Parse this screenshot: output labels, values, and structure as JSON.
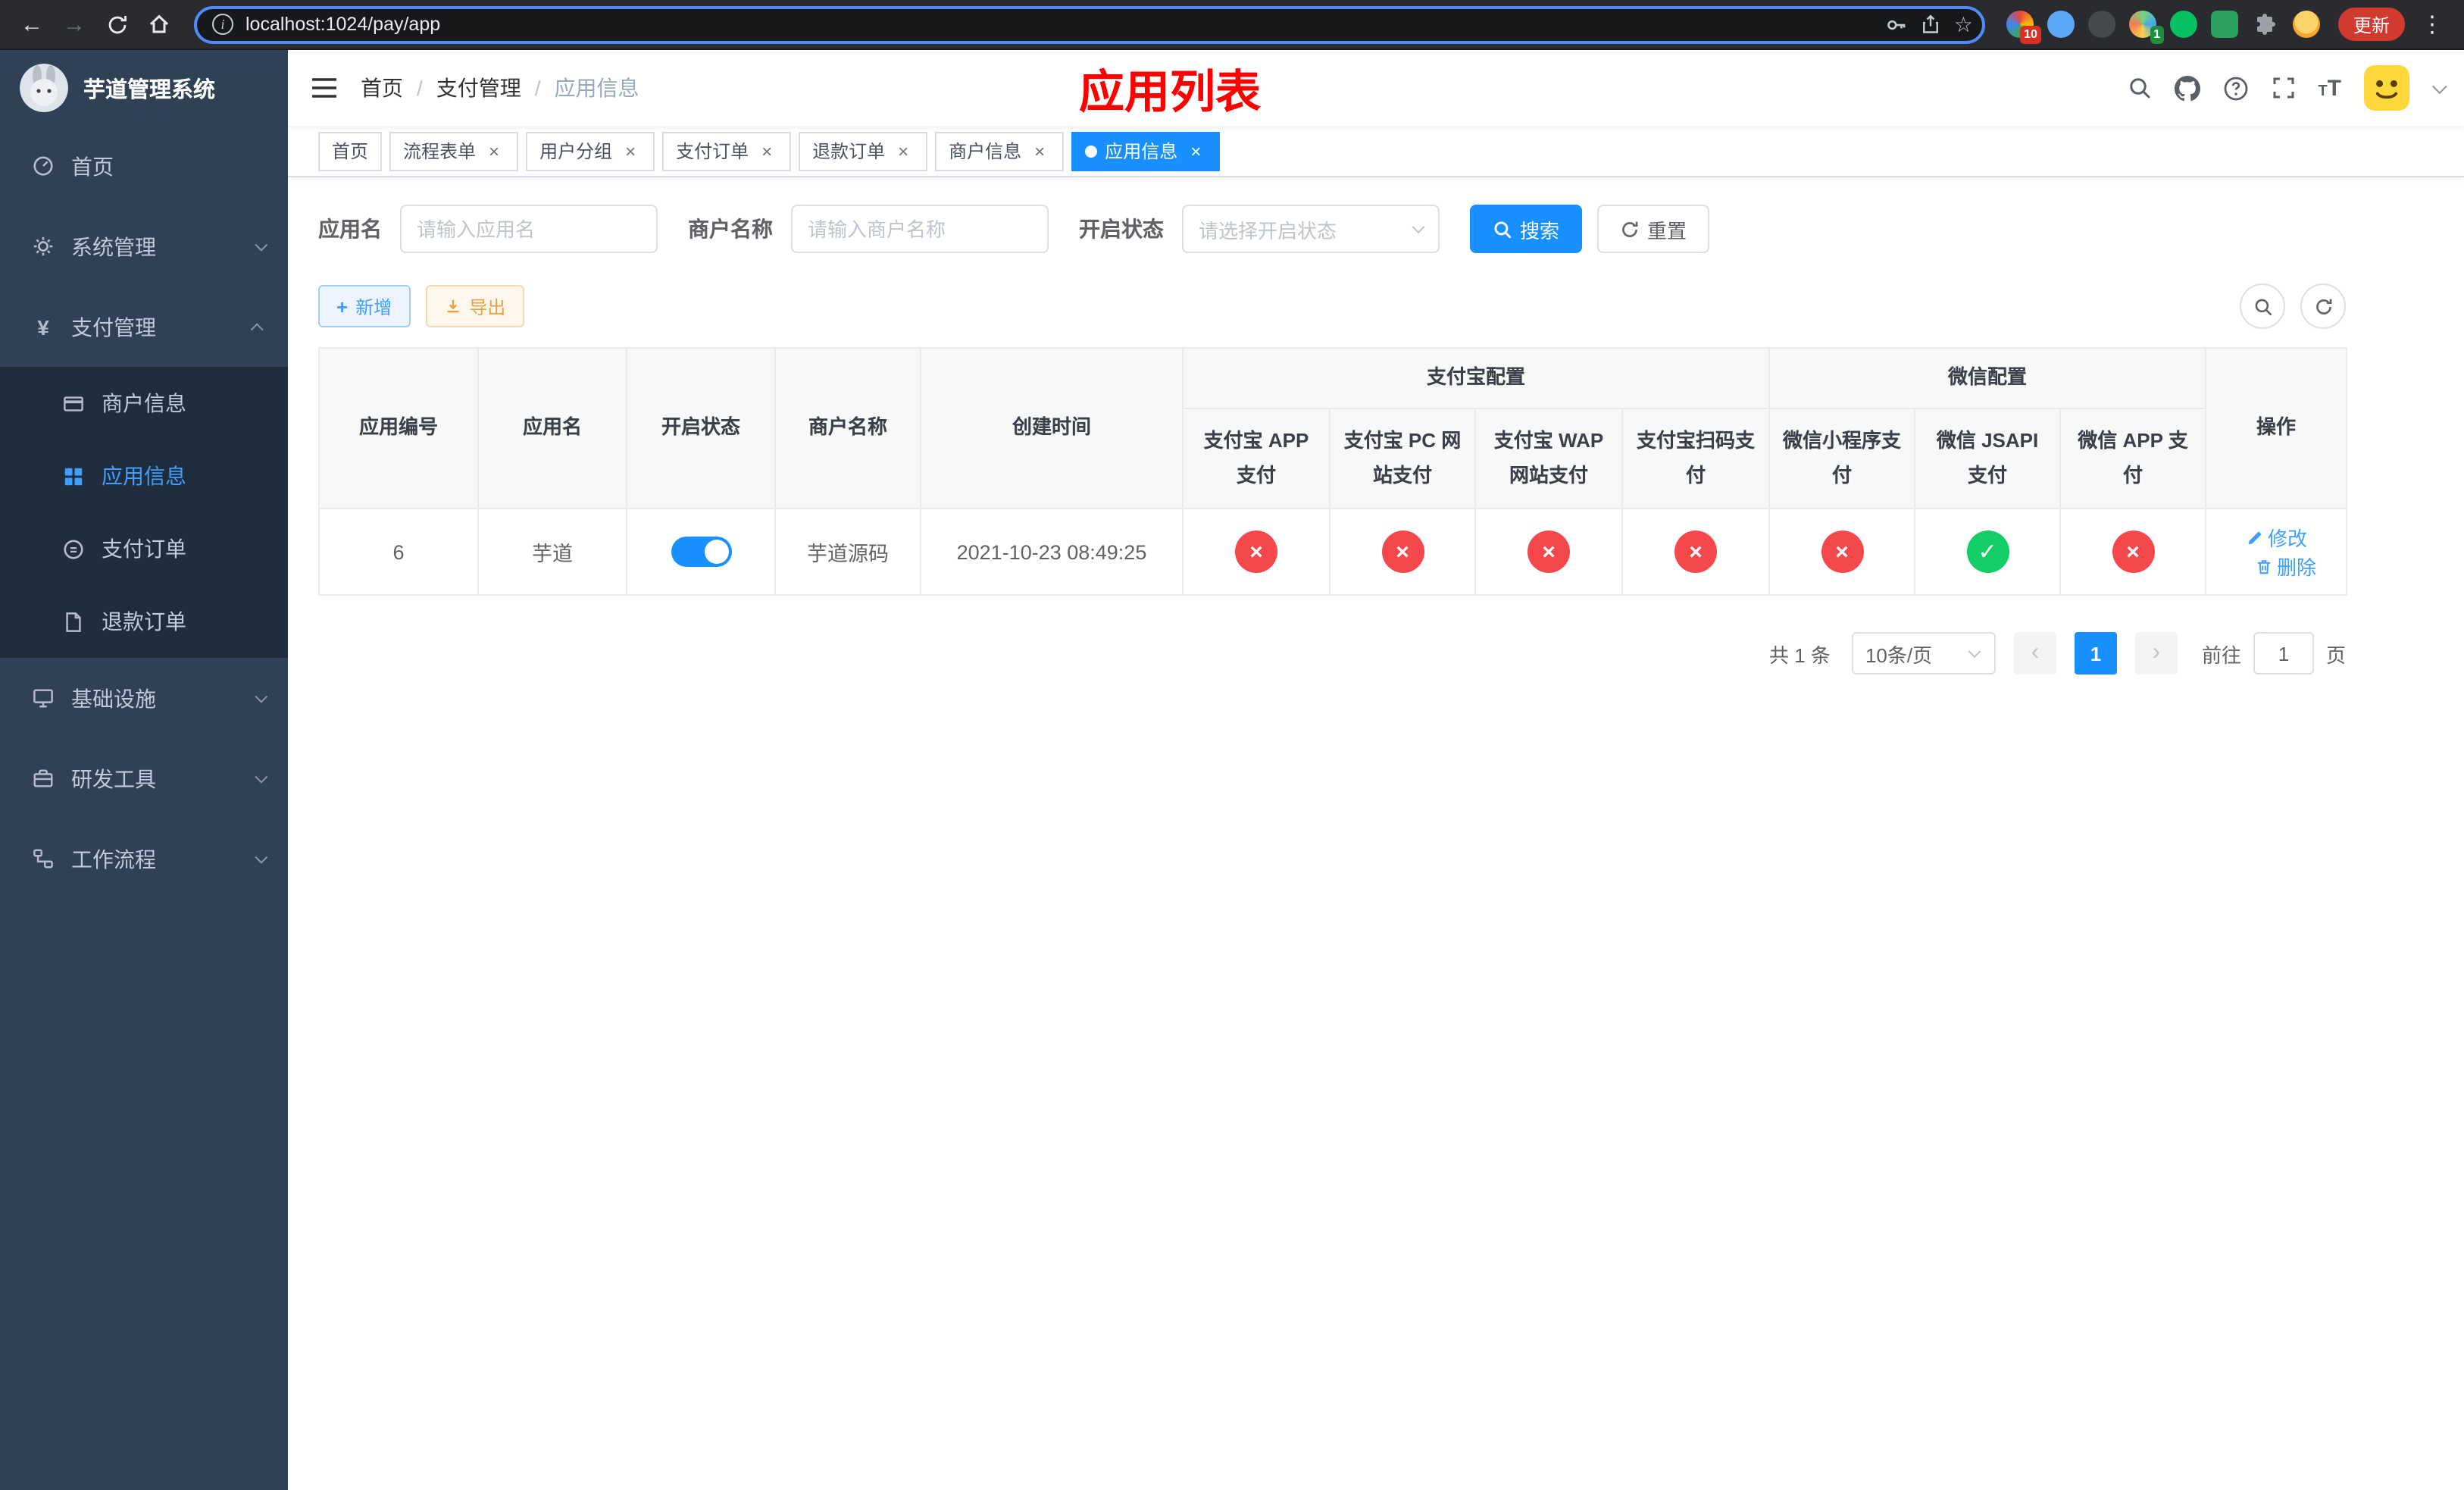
{
  "browser": {
    "url": "localhost:1024/pay/app",
    "update_label": "更新",
    "ext_badges": {
      "first": "10",
      "second": "1"
    }
  },
  "sidebar": {
    "title": "芋道管理系统",
    "menu": [
      {
        "label": "首页"
      },
      {
        "label": "系统管理"
      },
      {
        "label": "支付管理"
      },
      {
        "label": "基础设施"
      },
      {
        "label": "研发工具"
      },
      {
        "label": "工作流程"
      }
    ],
    "submenu": [
      {
        "label": "商户信息"
      },
      {
        "label": "应用信息"
      },
      {
        "label": "支付订单"
      },
      {
        "label": "退款订单"
      }
    ]
  },
  "header": {
    "breadcrumb": [
      "首页",
      "支付管理",
      "应用信息"
    ],
    "page_title": "应用列表"
  },
  "tabs": [
    {
      "label": "首页",
      "closable": false
    },
    {
      "label": "流程表单",
      "closable": true
    },
    {
      "label": "用户分组",
      "closable": true
    },
    {
      "label": "支付订单",
      "closable": true
    },
    {
      "label": "退款订单",
      "closable": true
    },
    {
      "label": "商户信息",
      "closable": true
    },
    {
      "label": "应用信息",
      "closable": true,
      "active": true
    }
  ],
  "filters": {
    "app_name_label": "应用名",
    "app_name_placeholder": "请输入应用名",
    "merchant_label": "商户名称",
    "merchant_placeholder": "请输入商户名称",
    "status_label": "开启状态",
    "status_placeholder": "请选择开启状态",
    "search_label": "搜索",
    "reset_label": "重置"
  },
  "actions": {
    "add_label": "新增",
    "export_label": "导出"
  },
  "table": {
    "groups": {
      "alipay": "支付宝配置",
      "wechat": "微信配置"
    },
    "columns": {
      "app_id": "应用编号",
      "app_name": "应用名",
      "status": "开启状态",
      "merchant": "商户名称",
      "created": "创建时间",
      "ops": "操作"
    },
    "sub_columns": [
      "支付宝 APP 支付",
      "支付宝 PC 网站支付",
      "支付宝 WAP 网站支付",
      "支付宝扫码支付",
      "微信小程序支付",
      "微信 JSAPI 支付",
      "微信 APP 支付"
    ],
    "row": {
      "id": "6",
      "name": "芋道",
      "status_on": true,
      "merchant": "芋道源码",
      "created": "2021-10-23 08:49:25",
      "configs": [
        {
          "name": "alipay-app-pay",
          "enabled": false,
          "mark": "×"
        },
        {
          "name": "alipay-pc-pay",
          "enabled": false,
          "mark": "×"
        },
        {
          "name": "alipay-wap-pay",
          "enabled": false,
          "mark": "×"
        },
        {
          "name": "alipay-qr-pay",
          "enabled": false,
          "mark": "×"
        },
        {
          "name": "wechat-mini-pay",
          "enabled": false,
          "mark": "×"
        },
        {
          "name": "wechat-jsapi-pay",
          "enabled": true,
          "mark": "✓"
        },
        {
          "name": "wechat-app-pay",
          "enabled": false,
          "mark": "×"
        }
      ],
      "edit_label": "修改",
      "delete_label": "删除"
    }
  },
  "pagination": {
    "total": "共 1 条",
    "page_size": "10条/页",
    "page": "1",
    "goto_label": "前往",
    "goto_value": "1",
    "unit_label": "页"
  },
  "icons": {
    "back": "←",
    "forward": "→",
    "star": "☆",
    "dots": "⋮",
    "close": "×",
    "check": "✓",
    "plus": "+",
    "yen": "¥",
    "prev": "‹",
    "next": "›"
  },
  "colors": {
    "accent": "#1890ff",
    "link": "#409eff",
    "danger": "#f5484d",
    "success": "#13ce66",
    "title_red": "#ff0000",
    "sidebar_bg": "#304156",
    "submenu_bg": "#1f2d3d"
  }
}
